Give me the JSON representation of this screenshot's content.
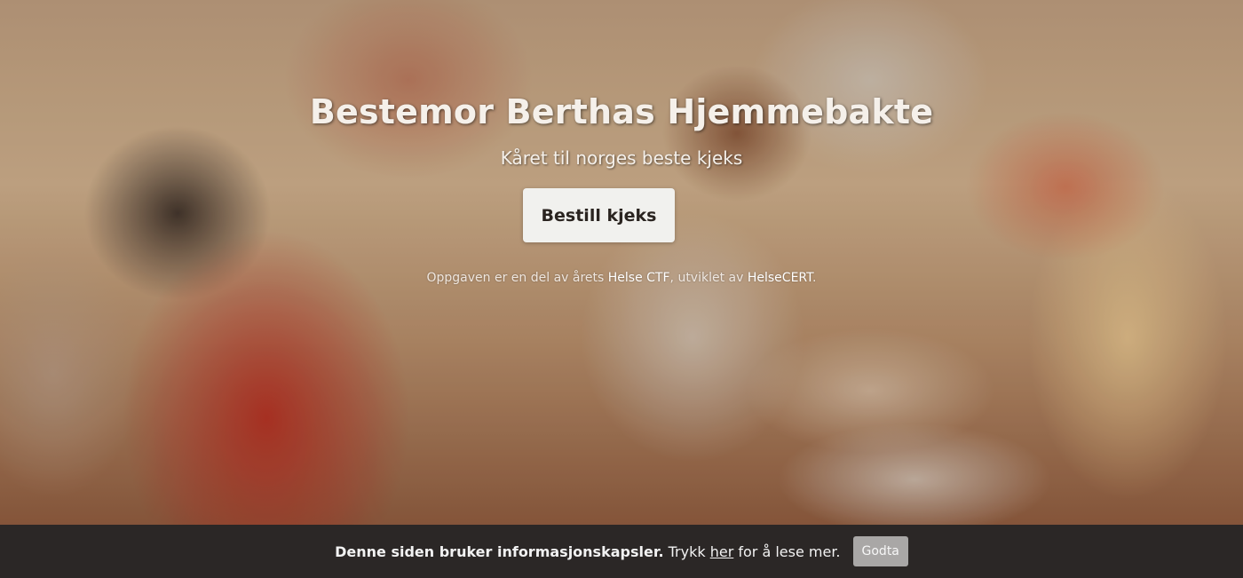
{
  "hero": {
    "title": "Bestemor Berthas Hjemmebakte",
    "subtitle": "Kåret til norges beste kjeks",
    "order_button_label": "Bestill kjeks",
    "credit_prefix": "Oppgaven er en del av årets ",
    "credit_event": "Helse CTF",
    "credit_middle": ", utviklet av ",
    "credit_org": "HelseCERT",
    "credit_suffix": "."
  },
  "cookie_bar": {
    "message_bold": "Denne siden bruker informasjonskapsler.",
    "message_before_link": "Trykk",
    "link_label": "her",
    "message_after_link": "for å lese mer.",
    "accept_label": "Godta"
  }
}
